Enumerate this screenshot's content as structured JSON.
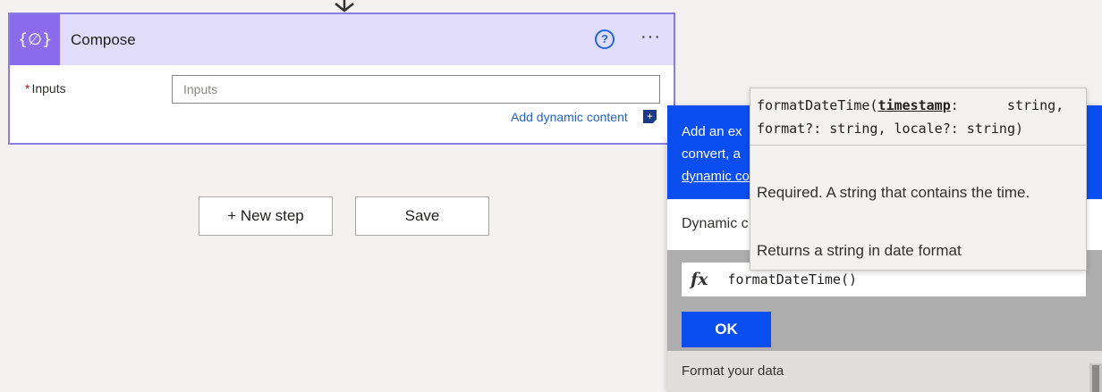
{
  "compose_card": {
    "title": "Compose",
    "action_icon": "{∅}",
    "inputs_label": "Inputs",
    "inputs_placeholder": "Inputs",
    "add_dynamic_content": "Add dynamic content",
    "plus_symbol": "+",
    "help_symbol": "?",
    "more_symbol": "···"
  },
  "buttons": {
    "new_step": "+ New step",
    "save": "Save"
  },
  "expression_panel": {
    "banner_line1": "Add an ex",
    "banner_line2": "convert, a",
    "banner_link": "dynamic co",
    "tab_partial": "Dynamic c",
    "fx": "fx",
    "expression": "formatDateTime()",
    "ok": "OK",
    "format_section": "Format your data"
  },
  "tooltip": {
    "fn_name": "formatDateTime(",
    "param": "timestamp",
    "sig_rest1": ":      string,",
    "sig_line2": "format?: string, locale?: string)",
    "description": "Required. A string that contains the time.",
    "returns": "Returns a string in date format"
  },
  "colors": {
    "accent_purple": "#8c6cec",
    "panel_blue": "#0b4ef0",
    "link_blue": "#2462c8"
  }
}
